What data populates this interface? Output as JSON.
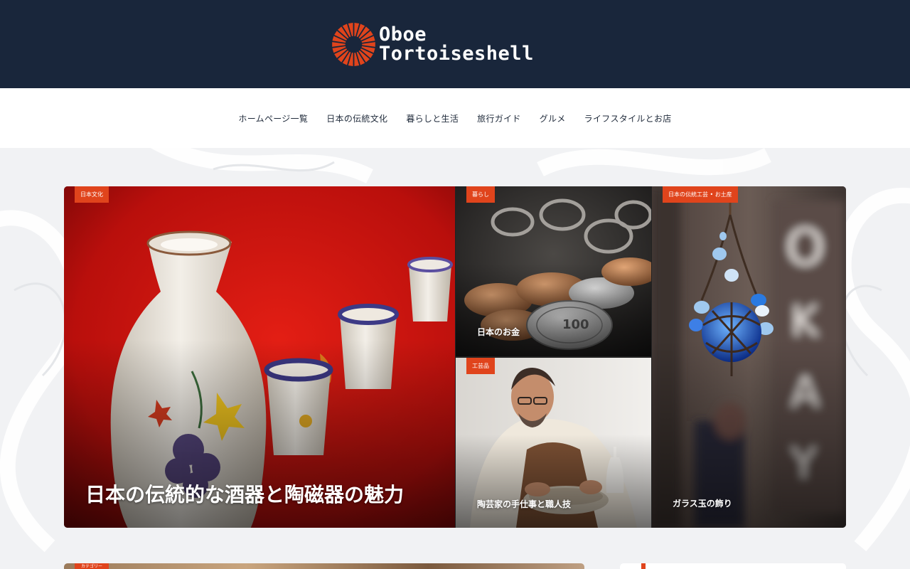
{
  "brand": {
    "name_line1": "Oboe",
    "name_line2": "Tortoiseshell",
    "accent_color": "#e0441c",
    "header_color": "#19263b"
  },
  "nav": {
    "items": [
      "ホームページ一覧",
      "日本の伝統文化",
      "暮らしと生活",
      "旅行ガイド",
      "グルメ",
      "ライフスタイルとお店"
    ]
  },
  "featured": {
    "main": {
      "badge": "日本文化",
      "title": "日本の伝統的な酒器と陶磁器の魅力"
    },
    "coins": {
      "badge": "暮らし",
      "title": "日本のお金"
    },
    "potter": {
      "badge": "工芸品",
      "title": "陶芸家の手仕事と職人技"
    },
    "charm": {
      "badge": "日本の伝統工芸 • お土産",
      "title": "ガラス玉の飾り"
    }
  },
  "next_post": {
    "badge": "カテゴリー"
  }
}
